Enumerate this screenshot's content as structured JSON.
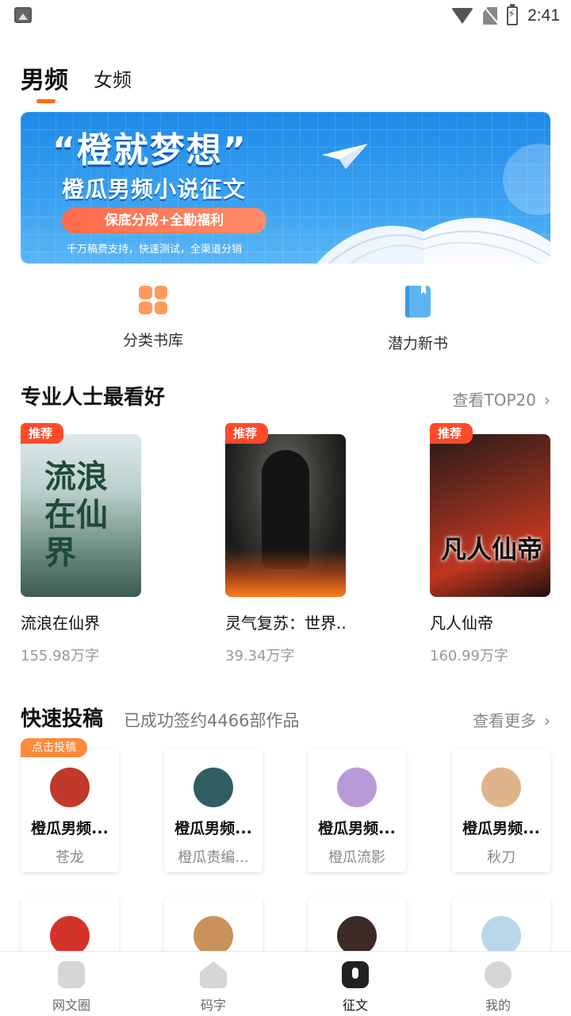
{
  "status_bar": {
    "time": "2:41",
    "icons": [
      "image-icon",
      "wifi-icon",
      "no-sim-icon",
      "battery-charging-icon"
    ]
  },
  "tabs": [
    {
      "label": "男频",
      "active": true
    },
    {
      "label": "女频",
      "active": false
    }
  ],
  "banner": {
    "title": "“橙就梦想”",
    "subtitle": "橙瓜男频小说征文",
    "pill": "保底分成+全勤福利",
    "note": "千万稿费支持，快速测试，全渠道分销",
    "colors": {
      "background": "#2a93ec",
      "pill": "#ff7454"
    }
  },
  "entries": [
    {
      "label": "分类书库",
      "icon": "grid-icon"
    },
    {
      "label": "潜力新书",
      "icon": "book-icon"
    }
  ],
  "recommend": {
    "title": "专业人士最看好",
    "more": "查看TOP20",
    "books": [
      {
        "tag": "推荐",
        "cover_text": "流浪在仙界",
        "name": "流浪在仙界",
        "words": "155.98万字"
      },
      {
        "tag": "推荐",
        "cover_text": "",
        "name": "灵气复苏：世界...",
        "words": "39.34万字"
      },
      {
        "tag": "推荐",
        "cover_text": "凡人仙帝",
        "name": "凡人仙帝",
        "words": "160.99万字"
      }
    ]
  },
  "submit": {
    "title": "快速投稿",
    "subtitle": "已成功签约4466部作品",
    "more": "查看更多",
    "badge": "点击投稿",
    "authors": [
      {
        "name": "橙瓜男频...",
        "editor": "苍龙",
        "avatar_color": "#c0392b"
      },
      {
        "name": "橙瓜男频...",
        "editor": "橙瓜责编...",
        "avatar_color": "#2f5d62"
      },
      {
        "name": "橙瓜男频...",
        "editor": "橙瓜流影",
        "avatar_color": "#b79ad8"
      },
      {
        "name": "橙瓜男频...",
        "editor": "秋刀",
        "avatar_color": "#e0b48a"
      },
      {
        "name": "",
        "editor": "",
        "avatar_color": "#d4332a"
      },
      {
        "name": "",
        "editor": "",
        "avatar_color": "#c9925a"
      },
      {
        "name": "",
        "editor": "",
        "avatar_color": "#3b2a26"
      },
      {
        "name": "",
        "editor": "",
        "avatar_color": "#b8d8ea"
      }
    ]
  },
  "bottom_nav": [
    {
      "label": "网文圈",
      "active": false
    },
    {
      "label": "码字",
      "active": false
    },
    {
      "label": "征文",
      "active": true
    },
    {
      "label": "我的",
      "active": false
    }
  ],
  "accent_color": "#ff6a1a"
}
